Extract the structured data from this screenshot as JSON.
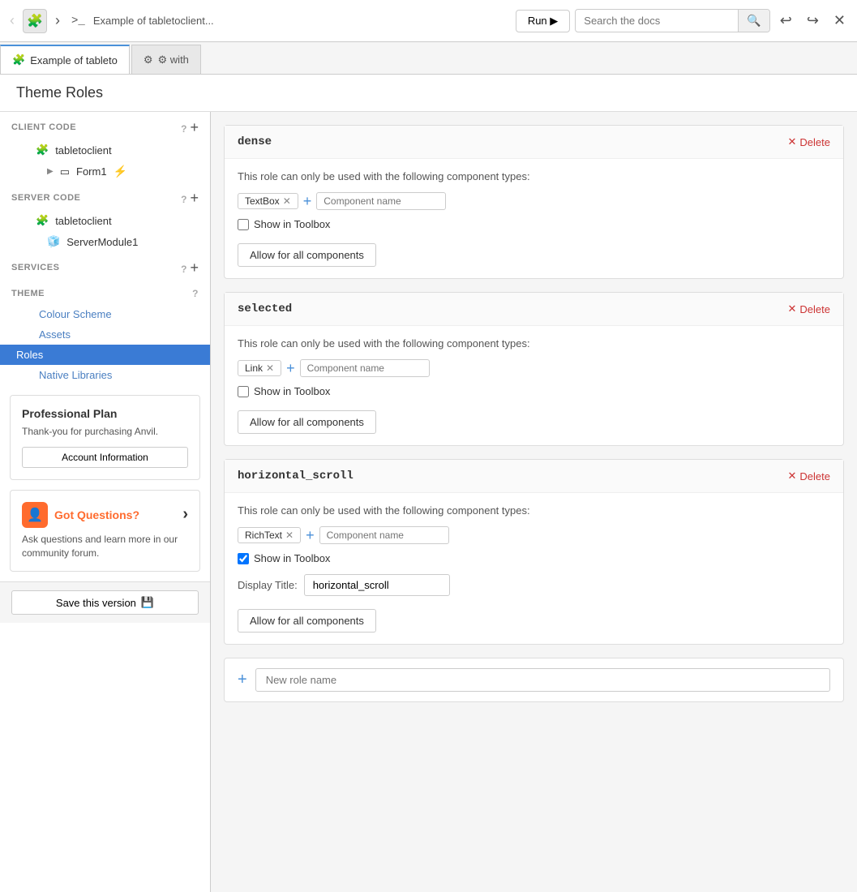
{
  "topbar": {
    "app_title": "Example of tabletoclient...",
    "run_label": "Run ▶",
    "search_placeholder": "Search the docs",
    "undo_title": "Undo",
    "redo_title": "Redo",
    "close_title": "Close"
  },
  "tabs": [
    {
      "label": "Example of tableto",
      "icon": "🧩",
      "active": true
    },
    {
      "label": "⚙ with",
      "icon": "",
      "active": false
    }
  ],
  "page_title": "Theme Roles",
  "sidebar": {
    "client_code_label": "CLIENT CODE",
    "server_code_label": "SERVER CODE",
    "services_label": "SERVICES",
    "theme_label": "THEME",
    "items": {
      "tabletoclient1": "tabletoclient",
      "form1": "Form1",
      "tabletoclient2": "tabletoclient",
      "server_module": "ServerModule1",
      "colour_scheme": "Colour Scheme",
      "assets": "Assets",
      "roles": "Roles",
      "native_libraries": "Native Libraries"
    }
  },
  "plan_card": {
    "title": "Professional Plan",
    "text": "Thank-you for purchasing Anvil.",
    "button_label": "Account Information"
  },
  "questions_card": {
    "title": "Got Questions?",
    "text": "Ask questions and learn more in our community forum."
  },
  "save_button": "Save this version",
  "roles": [
    {
      "name": "dense",
      "description": "This role can only be used with the following component types:",
      "tags": [
        "TextBox"
      ],
      "component_placeholder": "Component name",
      "show_in_toolbox": false,
      "allow_label": "Allow for all components",
      "delete_label": "Delete"
    },
    {
      "name": "selected",
      "description": "This role can only be used with the following component types:",
      "tags": [
        "Link"
      ],
      "component_placeholder": "Component name",
      "show_in_toolbox": false,
      "allow_label": "Allow for all components",
      "delete_label": "Delete"
    },
    {
      "name": "horizontal_scroll",
      "description": "This role can only be used with the following component types:",
      "tags": [
        "RichText"
      ],
      "component_placeholder": "Component name",
      "show_in_toolbox": true,
      "display_title_label": "Display Title:",
      "display_title_value": "horizontal_scroll",
      "allow_label": "Allow for all components",
      "delete_label": "Delete"
    }
  ],
  "new_role": {
    "placeholder": "New role name"
  }
}
